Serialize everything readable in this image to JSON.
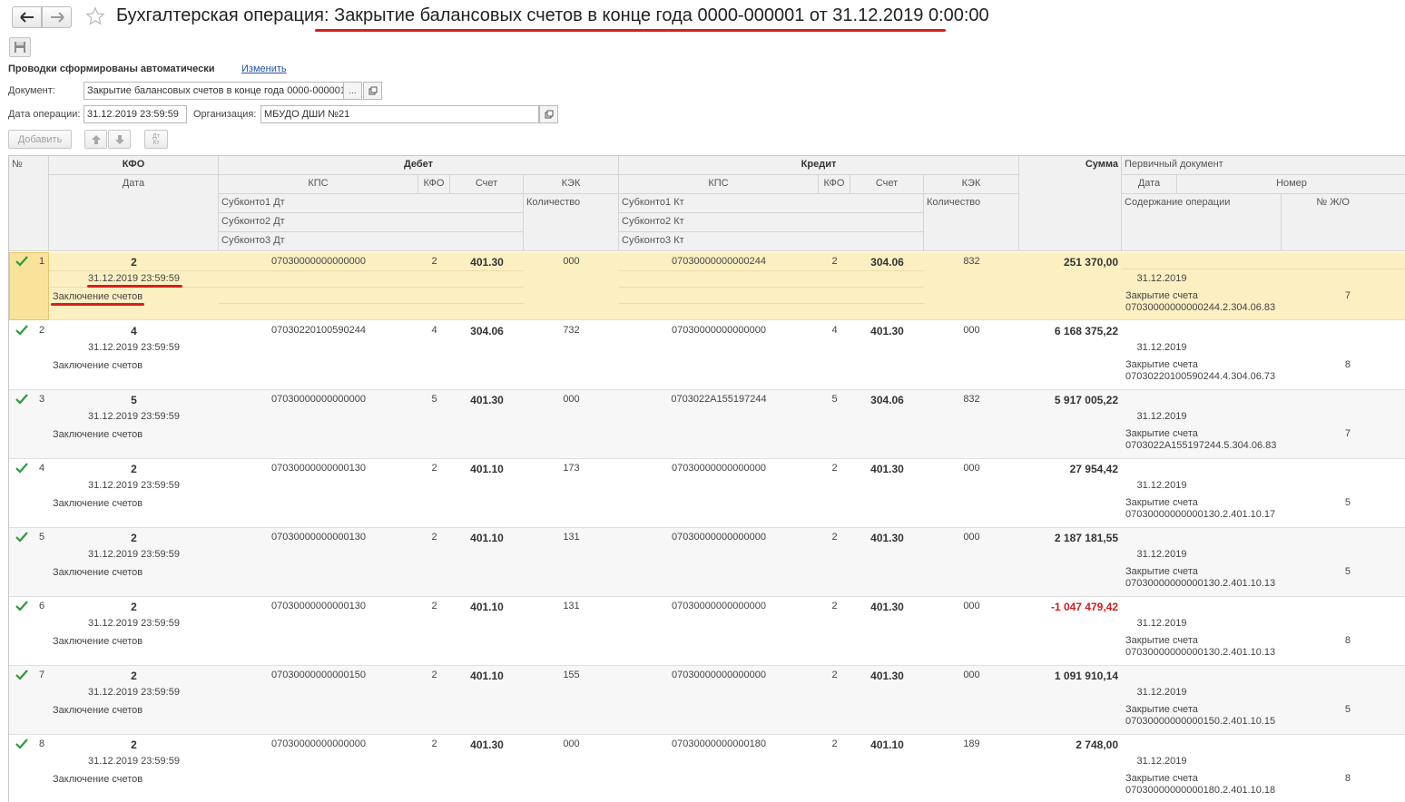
{
  "window": {
    "title": "Бухгалтерская операция: Закрытие балансовых счетов в конце года 0000-000001 от 31.12.2019 0:00:00"
  },
  "form": {
    "auto_text": "Проводки сформированы автоматически",
    "change_link": "Изменить",
    "document_label": "Документ:",
    "document_value": "Закрытие балансовых счетов в конце года 0000-000001",
    "document_select": "...",
    "date_label": "Дата операции:",
    "date_value": "31.12.2019 23:59:59",
    "org_label": "Организация:",
    "org_value": "МБУДО ДШИ  №21"
  },
  "toolbar": {
    "add_label": "Добавить",
    "sort_label": "Дт\nКт"
  },
  "headers": {
    "num": "№",
    "kfo": "КФО",
    "date": "Дата",
    "debit": "Дебет",
    "credit": "Кредит",
    "kps": "КПС",
    "kfo_small": "КФО",
    "account": "Счет",
    "kek": "КЭК",
    "qty": "Количество",
    "sub1_dt": "Субконто1 Дт",
    "sub2_dt": "Субконто2 Дт",
    "sub3_dt": "Субконто3 Дт",
    "sub1_kt": "Субконто1 Кт",
    "sub2_kt": "Субконто2 Кт",
    "sub3_kt": "Субконто3 Кт",
    "sum": "Сумма",
    "primary_doc": "Первичный документ",
    "pdate": "Дата",
    "pnum": "Номер",
    "content": "Содержание операции",
    "journal": "№ Ж/О"
  },
  "rows": [
    {
      "n": "1",
      "kfo": "2",
      "date": "31.12.2019 23:59:59",
      "desc": "Заключение счетов",
      "dt_kps": "07030000000000000",
      "dt_kfo": "2",
      "dt_acc": "401.30",
      "dt_kek": "000",
      "kt_kps": "07030000000000244",
      "kt_kfo": "2",
      "kt_acc": "304.06",
      "kt_kek": "832",
      "sum": "251 370,00",
      "pdate": "31.12.2019",
      "content1": "Закрытие счета",
      "content2": "07030000000000244.2.304.06.83",
      "journal": "7"
    },
    {
      "n": "2",
      "kfo": "4",
      "date": "31.12.2019 23:59:59",
      "desc": "Заключение счетов",
      "dt_kps": "07030220100590244",
      "dt_kfo": "4",
      "dt_acc": "304.06",
      "dt_kek": "732",
      "kt_kps": "07030000000000000",
      "kt_kfo": "4",
      "kt_acc": "401.30",
      "kt_kek": "000",
      "sum": "6 168 375,22",
      "pdate": "31.12.2019",
      "content1": "Закрытие счета",
      "content2": "07030220100590244.4.304.06.73",
      "journal": "8"
    },
    {
      "n": "3",
      "kfo": "5",
      "date": "31.12.2019 23:59:59",
      "desc": "Заключение счетов",
      "dt_kps": "07030000000000000",
      "dt_kfo": "5",
      "dt_acc": "401.30",
      "dt_kek": "000",
      "kt_kps": "0703022A155197244",
      "kt_kfo": "5",
      "kt_acc": "304.06",
      "kt_kek": "832",
      "sum": "5 917 005,22",
      "pdate": "31.12.2019",
      "content1": "Закрытие счета",
      "content2": "0703022A155197244.5.304.06.83",
      "journal": "7"
    },
    {
      "n": "4",
      "kfo": "2",
      "date": "31.12.2019 23:59:59",
      "desc": "Заключение счетов",
      "dt_kps": "07030000000000130",
      "dt_kfo": "2",
      "dt_acc": "401.10",
      "dt_kek": "173",
      "kt_kps": "07030000000000000",
      "kt_kfo": "2",
      "kt_acc": "401.30",
      "kt_kek": "000",
      "sum": "27 954,42",
      "pdate": "31.12.2019",
      "content1": "Закрытие счета",
      "content2": "07030000000000130.2.401.10.17",
      "journal": "5"
    },
    {
      "n": "5",
      "kfo": "2",
      "date": "31.12.2019 23:59:59",
      "desc": "Заключение счетов",
      "dt_kps": "07030000000000130",
      "dt_kfo": "2",
      "dt_acc": "401.10",
      "dt_kek": "131",
      "kt_kps": "07030000000000000",
      "kt_kfo": "2",
      "kt_acc": "401.30",
      "kt_kek": "000",
      "sum": "2 187 181,55",
      "pdate": "31.12.2019",
      "content1": "Закрытие счета",
      "content2": "07030000000000130.2.401.10.13",
      "journal": "5"
    },
    {
      "n": "6",
      "kfo": "2",
      "date": "31.12.2019 23:59:59",
      "desc": "Заключение счетов",
      "dt_kps": "07030000000000130",
      "dt_kfo": "2",
      "dt_acc": "401.10",
      "dt_kek": "131",
      "kt_kps": "07030000000000000",
      "kt_kfo": "2",
      "kt_acc": "401.30",
      "kt_kek": "000",
      "sum": "-1 047 479,42",
      "pdate": "31.12.2019",
      "content1": "Закрытие счета",
      "content2": "07030000000000130.2.401.10.13",
      "journal": "8"
    },
    {
      "n": "7",
      "kfo": "2",
      "date": "31.12.2019 23:59:59",
      "desc": "Заключение счетов",
      "dt_kps": "07030000000000150",
      "dt_kfo": "2",
      "dt_acc": "401.10",
      "dt_kek": "155",
      "kt_kps": "07030000000000000",
      "kt_kfo": "2",
      "kt_acc": "401.30",
      "kt_kek": "000",
      "sum": "1 091 910,14",
      "pdate": "31.12.2019",
      "content1": "Закрытие счета",
      "content2": "07030000000000150.2.401.10.15",
      "journal": "5"
    },
    {
      "n": "8",
      "kfo": "2",
      "date": "31.12.2019 23:59:59",
      "desc": "Заключение счетов",
      "dt_kps": "07030000000000000",
      "dt_kfo": "2",
      "dt_acc": "401.30",
      "dt_kek": "000",
      "kt_kps": "07030000000000180",
      "kt_kfo": "2",
      "kt_acc": "401.10",
      "kt_kek": "189",
      "sum": "2 748,00",
      "pdate": "31.12.2019",
      "content1": "Закрытие счета",
      "content2": "07030000000000180.2.401.10.18",
      "journal": "8"
    }
  ],
  "colors": {
    "selected_row": "#fcf0c3",
    "check": "#2e9a3a",
    "negative": "#d01d1d",
    "annotation": "#d81e1e",
    "link": "#2553a8"
  },
  "icons": [
    "back-arrow-icon",
    "forward-arrow-icon",
    "star-icon",
    "save-icon",
    "open-icon",
    "up-arrow-icon",
    "down-arrow-icon",
    "check-icon"
  ]
}
